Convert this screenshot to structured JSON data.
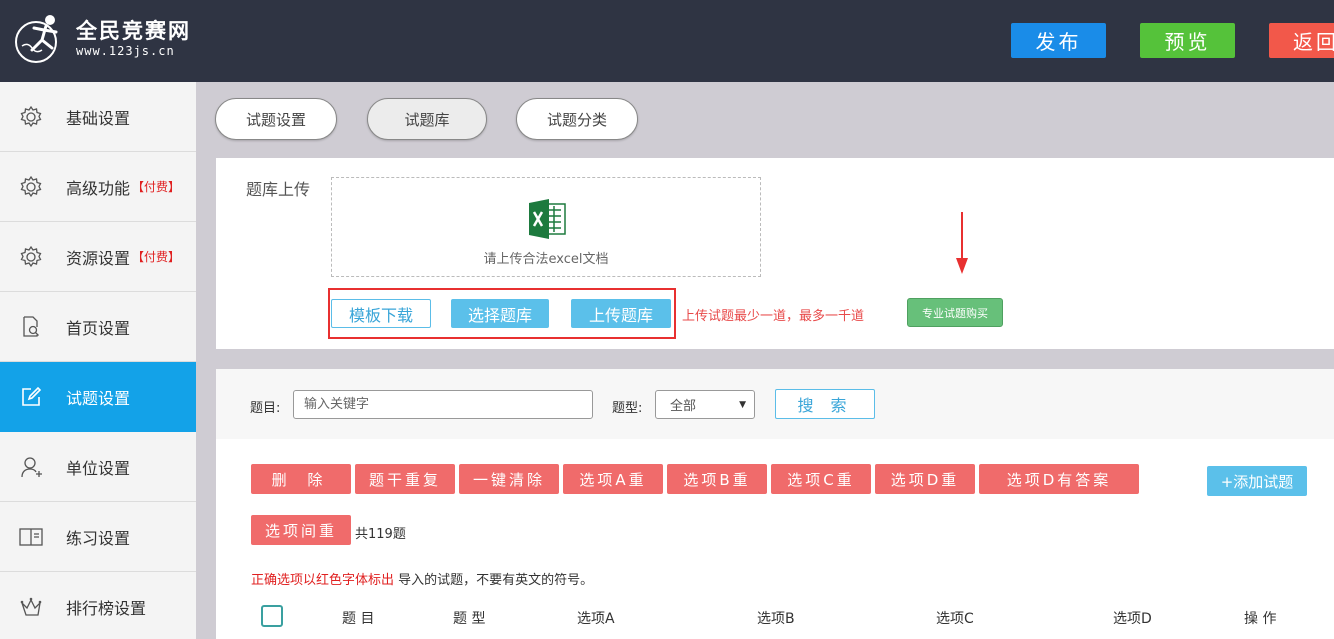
{
  "header": {
    "logo_title": "全民竞赛网",
    "logo_url": "www.123js.cn",
    "publish": "发布",
    "preview": "预览",
    "back": "返回"
  },
  "sidebar": {
    "items": [
      {
        "label": "基础设置",
        "icon": "gear-icon"
      },
      {
        "label": "高级功能",
        "badge": "【付费】",
        "icon": "gear-icon"
      },
      {
        "label": "资源设置",
        "badge": "【付费】",
        "icon": "gear-icon"
      },
      {
        "label": "首页设置",
        "icon": "document-search-icon"
      },
      {
        "label": "试题设置",
        "icon": "edit-icon",
        "active": true
      },
      {
        "label": "单位设置",
        "icon": "user-add-icon"
      },
      {
        "label": "练习设置",
        "icon": "book-icon"
      },
      {
        "label": "排行榜设置",
        "icon": "crown-icon"
      }
    ]
  },
  "tabs": [
    "试题设置",
    "试题库",
    "试题分类"
  ],
  "upload": {
    "label": "题库上传",
    "dropzone_text": "请上传合法excel文档",
    "template_btn": "模板下载",
    "choose_btn": "选择题库",
    "upload_btn": "上传题库",
    "tip": "上传试题最少一道，最多一千道",
    "buy_btn": "专业试题购买"
  },
  "search": {
    "title_label": "题目:",
    "placeholder": "输入关键字",
    "type_label": "题型:",
    "type_value": "全部",
    "search_btn": "搜 索"
  },
  "actions": {
    "delete": "删  除",
    "dup_stem": "题干重复",
    "clear_all": "一键清除",
    "dup_a": "选项A重",
    "dup_b": "选项B重",
    "dup_c": "选项C重",
    "dup_d": "选项D重",
    "d_has_answer": "选项D有答案",
    "dup_between": "选项间重",
    "add": "+添加试题"
  },
  "total": "共119题",
  "note": {
    "red": "正确选项以红色字体标出",
    "rest": " 导入的试题，不要有英文的符号。"
  },
  "table": {
    "headers": [
      "题 目",
      "题 型",
      "选项A",
      "选项B",
      "选项C",
      "选项D",
      "操 作"
    ]
  },
  "colors": {
    "header_bg": "#2f3443",
    "active_blue": "#13a2e8",
    "danger_red": "#f06b6b",
    "accent_blue": "#5bc0ea",
    "green": "#55c23a"
  }
}
